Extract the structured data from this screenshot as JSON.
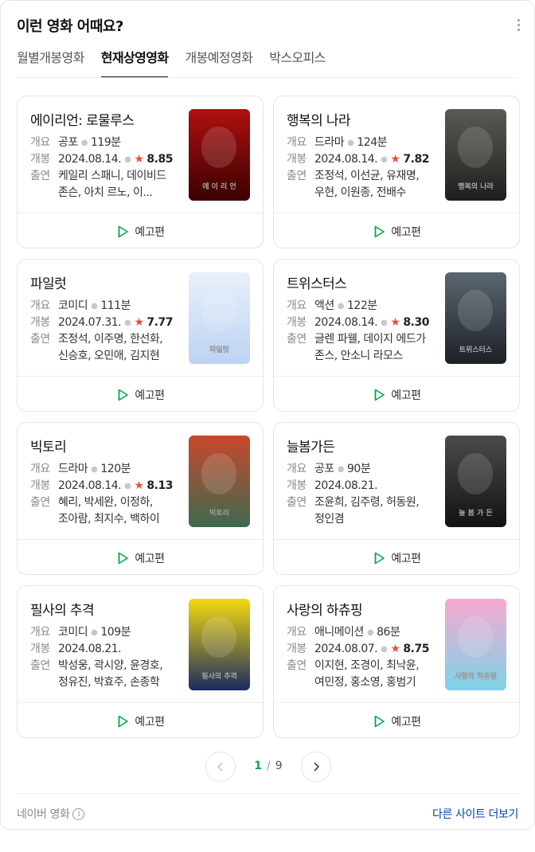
{
  "header": {
    "title": "이런 영화 어때요?"
  },
  "tabs": [
    {
      "label": "월별개봉영화",
      "active": false
    },
    {
      "label": "현재상영영화",
      "active": true
    },
    {
      "label": "개봉예정영화",
      "active": false
    },
    {
      "label": "박스오피스",
      "active": false
    }
  ],
  "labels": {
    "genre": "개요",
    "release": "개봉",
    "cast": "출연",
    "trailer": "예고편",
    "star": "★"
  },
  "movies": [
    {
      "title": "에이리언: 로물루스",
      "genre": "공포",
      "runtime": "119분",
      "date": "2024.08.14.",
      "rating": "8.85",
      "cast": "케일리 스패니, 데이비드 존슨, 아치 르노, 이...",
      "poster_text": "에 이 리 언",
      "colors": [
        "#b01010",
        "#3a0000"
      ]
    },
    {
      "title": "행복의 나라",
      "genre": "드라마",
      "runtime": "124분",
      "date": "2024.08.14.",
      "rating": "7.82",
      "cast": "조정석, 이선균, 유재명, 우현, 이원종, 전배수",
      "poster_text": "행복의 나라",
      "colors": [
        "#5a5a55",
        "#1e1e1c"
      ]
    },
    {
      "title": "파일럿",
      "genre": "코미디",
      "runtime": "111분",
      "date": "2024.07.31.",
      "rating": "7.77",
      "cast": "조정석, 이주명, 한선화, 신승호, 오민애, 김지현",
      "poster_text": "파일럿",
      "colors": [
        "#e8f0fb",
        "#bcd3f2"
      ]
    },
    {
      "title": "트위스터스",
      "genre": "액션",
      "runtime": "122분",
      "date": "2024.08.14.",
      "rating": "8.30",
      "cast": "글렌 파웰, 데이지 에드가 존스, 안소니 라모스",
      "poster_text": "트위스터스",
      "colors": [
        "#5b6670",
        "#1c2026"
      ]
    },
    {
      "title": "빅토리",
      "genre": "드라마",
      "runtime": "120분",
      "date": "2024.08.14.",
      "rating": "8.13",
      "cast": "혜리, 박세완, 이정하, 조아람, 최지수, 백하이",
      "poster_text": "빅토리",
      "colors": [
        "#c9472c",
        "#3d6a4f"
      ]
    },
    {
      "title": "늘봄가든",
      "genre": "공포",
      "runtime": "90분",
      "date": "2024.08.21.",
      "rating": "",
      "cast": "조윤희, 김주령, 허동원, 정인겸",
      "poster_text": "늘 봄 가 든",
      "colors": [
        "#4a4c48",
        "#121311"
      ]
    },
    {
      "title": "필사의 추격",
      "genre": "코미디",
      "runtime": "109분",
      "date": "2024.08.21.",
      "rating": "",
      "cast": "박성웅, 곽시양, 윤경호, 정유진, 박효주, 손종학",
      "poster_text": "필사의 추격",
      "colors": [
        "#f5d90f",
        "#1b2a5e"
      ]
    },
    {
      "title": "사랑의 하츄핑",
      "genre": "애니메이션",
      "runtime": "86분",
      "date": "2024.08.07.",
      "rating": "8.75",
      "cast": "이지현, 조경이, 최낙윤, 여민정, 홍소영, 홍범기",
      "poster_text": "사랑의 하츄핑",
      "colors": [
        "#f7a9cf",
        "#7dd3e8"
      ]
    }
  ],
  "pagination": {
    "current": "1",
    "separator": "/",
    "total": "9"
  },
  "footer": {
    "source": "네이버 영화",
    "other_sites": "다른 사이트 더보기"
  },
  "icons": {
    "more": "more-vertical-icon",
    "play": "play-icon",
    "prev": "chevron-left-icon",
    "next": "chevron-right-icon",
    "info": "info-icon"
  },
  "colors": {
    "accent_green": "#03a94d",
    "star_red": "#f04a3c",
    "link_blue": "#0845a8"
  }
}
